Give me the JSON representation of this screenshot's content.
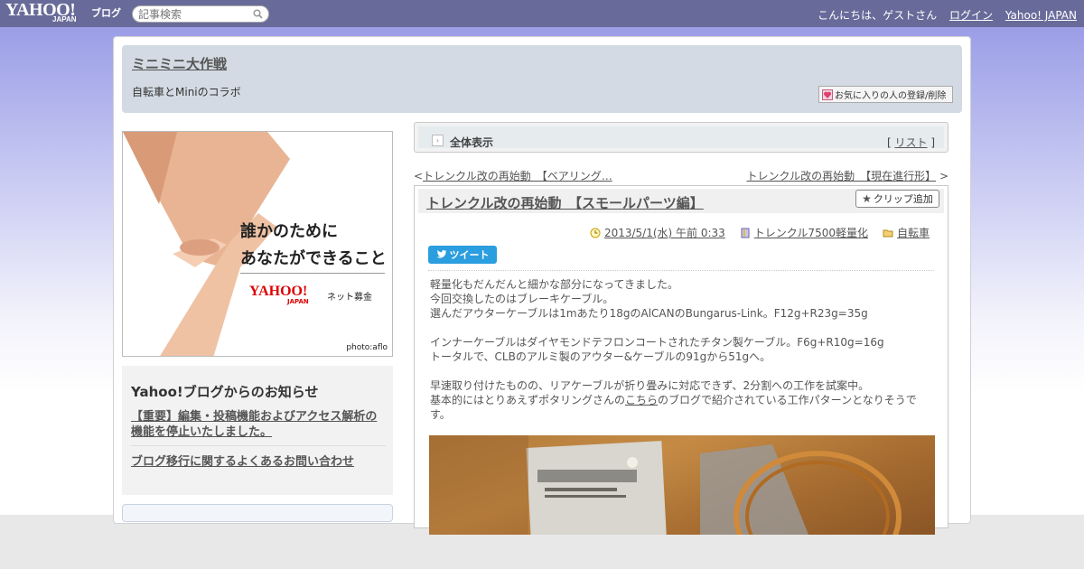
{
  "topbar": {
    "logo": "YAHOO!",
    "logo_sub": "JAPAN",
    "logo_blog": "ブログ",
    "search_placeholder": "記事検索",
    "greeting": "こんにちは、ゲストさん",
    "login": "ログイン",
    "yahoo_japan": "Yahoo! JAPAN"
  },
  "blog": {
    "title": "ミニミニ大作戦",
    "description": "自転車とMiniのコラボ",
    "fav_button": "お気に入りの人の登録/削除"
  },
  "banner": {
    "line1": "誰かのために",
    "line2": "あなたができること",
    "logo": "YAHOO!",
    "logo_sub": "JAPAN",
    "sub": "ネット募金",
    "credit": "photo:aflo"
  },
  "notice": {
    "title": "Yahoo!ブログからのお知らせ",
    "link1": "【重要】編集・投稿機能およびアクセス解析の機能を停止いたしました。",
    "link2": "ブログ移行に関するよくあるお問い合わせ"
  },
  "viewbar": {
    "label": "全体表示",
    "list_open": "[ ",
    "list": "リスト",
    "list_close": " ]"
  },
  "nav": {
    "prev_mark": "<",
    "prev": "トレンクル改の再始動　【ベアリング…",
    "next": "トレンクル改の再始動　【現在進行形】",
    "next_mark": " >"
  },
  "article": {
    "title": "トレンクル改の再始動　【スモールパーツ編】",
    "clip": "クリップ追加",
    "date": "2013/5/1(水) 午前 0:33",
    "category1": "トレンクル7500軽量化",
    "category2": "自転車",
    "tweet": "ツイート",
    "body": [
      "軽量化もだんだんと細かな部分になってきました。",
      "今回交換したのはブレーキケーブル。",
      "選んだアウターケーブルは1mあたり18gのAlCANのBungarus-Link。F12g+R23g=35g",
      "",
      "インナーケーブルはダイヤモンドテフロンコートされたチタン製ケーブル。F6g+R10g=16g",
      "トータルで、CLBのアルミ製のアウター&ケーブルの91gから51gへ。",
      "",
      "早速取り付けたものの、リアケーブルが折り畳みに対応できず、2分割への工作を試案中。"
    ],
    "body_last_pre": "基本的にはとりあえずポタリングさんの",
    "body_last_link": "こちら",
    "body_last_post": "のブログで紹介されている工作パターンとなりそうです。"
  }
}
